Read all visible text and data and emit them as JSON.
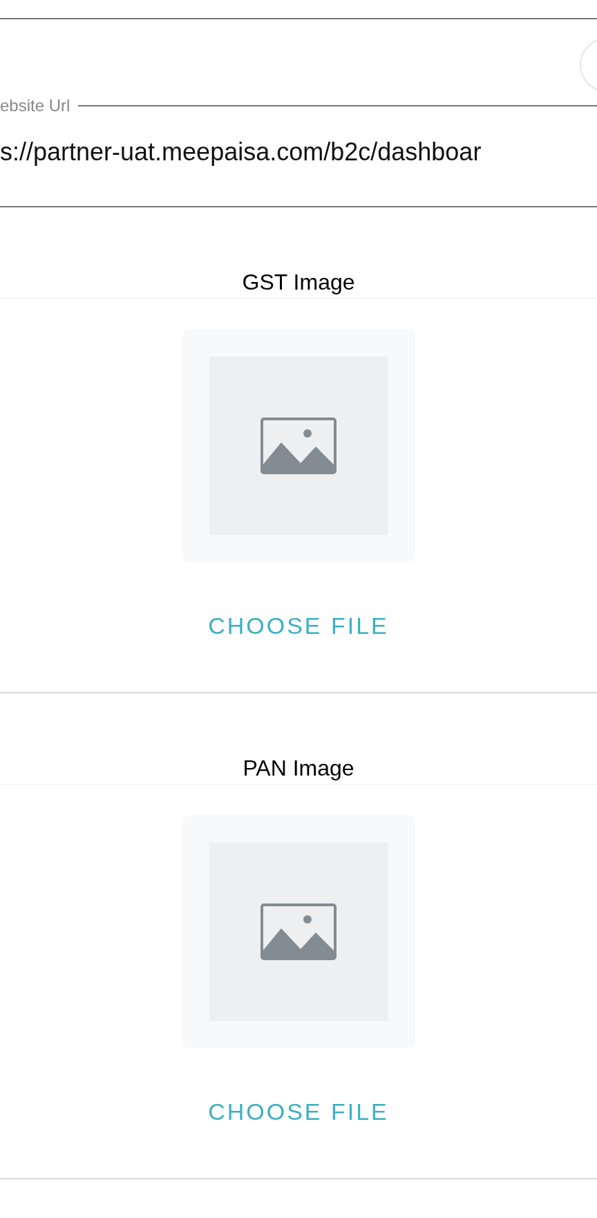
{
  "website_field": {
    "label": "ebsite Url",
    "value": "s://partner-uat.meepaisa.com/b2c/dashboar"
  },
  "uploads": [
    {
      "title": "GST Image",
      "button": "CHOOSE FILE"
    },
    {
      "title": "PAN Image",
      "button": "CHOOSE FILE"
    }
  ]
}
